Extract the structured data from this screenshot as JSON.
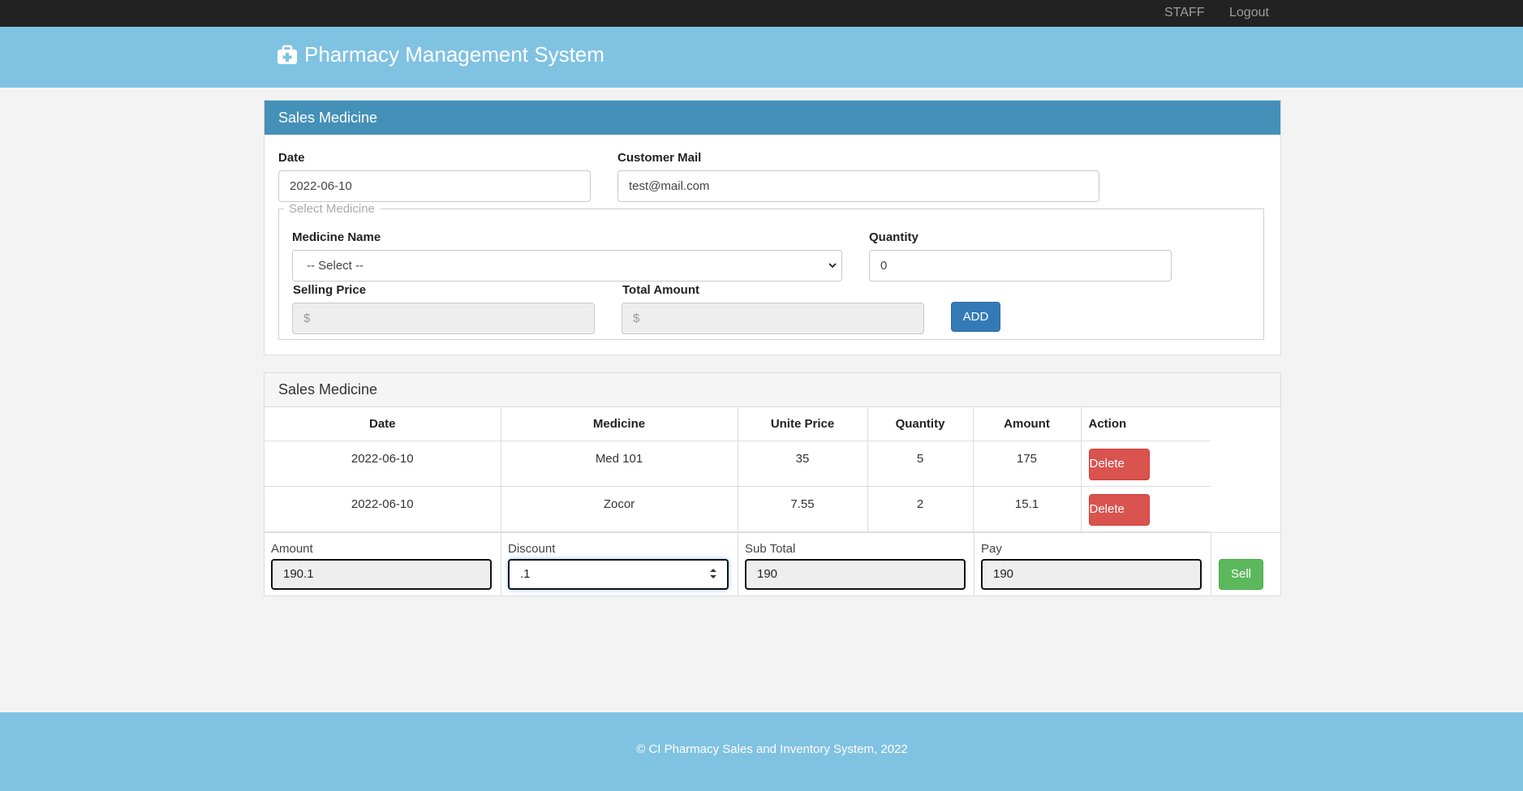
{
  "topnav": {
    "staff": "STAFF",
    "logout": "Logout"
  },
  "brand": {
    "title": "Pharmacy Management System",
    "icon": "medkit-icon"
  },
  "form_panel": {
    "title": "Sales Medicine",
    "date": {
      "label": "Date",
      "value": "2022-06-10"
    },
    "customer_mail": {
      "label": "Customer Mail",
      "value": "test@mail.com"
    },
    "select_medicine": {
      "legend": "Select Medicine",
      "medicine_name": {
        "label": "Medicine Name",
        "selected": "-- Select --"
      },
      "quantity": {
        "label": "Quantity",
        "value": "0"
      },
      "selling_price": {
        "label": "Selling Price",
        "value": "$"
      },
      "total_amount": {
        "label": "Total Amount",
        "value": "$"
      },
      "add_label": "ADD"
    }
  },
  "sales_panel": {
    "title": "Sales Medicine",
    "columns": [
      "Date",
      "Medicine",
      "Unite Price",
      "Quantity",
      "Amount",
      "Action"
    ],
    "rows": [
      {
        "date": "2022-06-10",
        "medicine": "Med 101",
        "unit_price": "35",
        "quantity": "5",
        "amount": "175",
        "action": "Delete"
      },
      {
        "date": "2022-06-10",
        "medicine": "Zocor",
        "unit_price": "7.55",
        "quantity": "2",
        "amount": "15.1",
        "action": "Delete"
      }
    ],
    "totals": {
      "amount": {
        "label": "Amount",
        "value": "190.1"
      },
      "discount": {
        "label": "Discount",
        "value": ".1"
      },
      "sub_total": {
        "label": "Sub Total",
        "value": "190"
      },
      "pay": {
        "label": "Pay",
        "value": "190"
      },
      "sell_label": "Sell"
    }
  },
  "footer": {
    "text": "© CI Pharmacy Sales and Inventory System, 2022"
  },
  "colors": {
    "topbar": "#222222",
    "brandbar": "#80c2e2",
    "panel_header": "#4490b8",
    "primary": "#337ab7",
    "danger": "#d9534f",
    "success": "#5cb85c"
  }
}
